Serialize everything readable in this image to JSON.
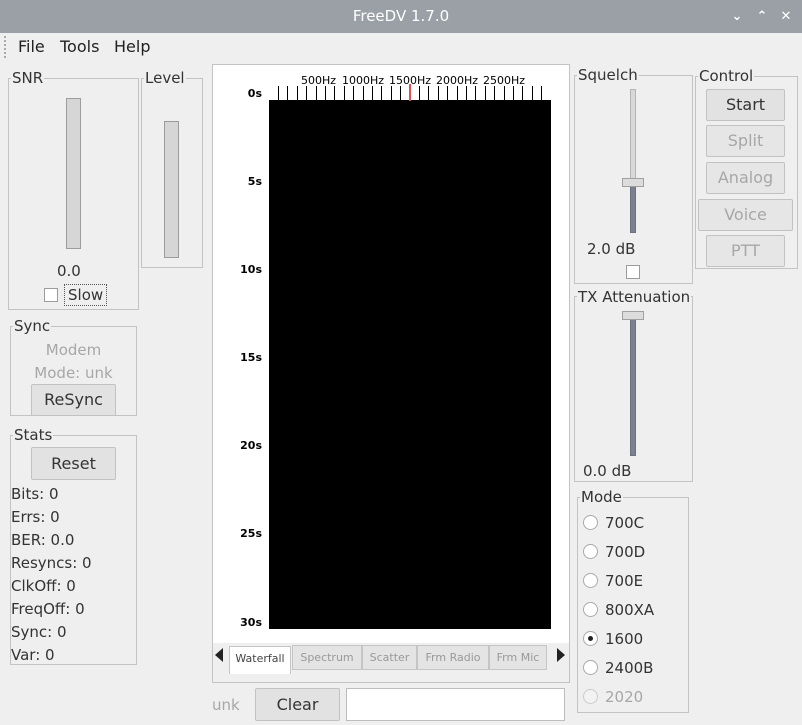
{
  "window": {
    "title": "FreeDV 1.7.0"
  },
  "menu": {
    "file": "File",
    "tools": "Tools",
    "help": "Help"
  },
  "snr": {
    "label": "SNR",
    "value": "0.0",
    "slow_label": "Slow"
  },
  "level": {
    "label": "Level"
  },
  "sync": {
    "label": "Sync",
    "modem": "Modem",
    "mode": "Mode: unk",
    "resync_label": "ReSync"
  },
  "stats": {
    "label": "Stats",
    "reset_label": "Reset",
    "lines": [
      "Bits: 0",
      "Errs: 0",
      "BER: 0.0",
      "Resyncs: 0",
      "ClkOff: 0",
      "FreqOff: 0",
      "Sync: 0",
      "Var: 0"
    ]
  },
  "waterfall": {
    "time_labels": [
      "0s",
      "5s",
      "10s",
      "15s",
      "20s",
      "25s",
      "30s"
    ],
    "freq_labels": [
      "500Hz",
      "1000Hz",
      "1500Hz",
      "2000Hz",
      "2500Hz"
    ],
    "background": "#000000",
    "marker_color": "#e05050"
  },
  "tabs": [
    "Waterfall",
    "Spectrum",
    "Scatter",
    "Frm Radio",
    "Frm Mic"
  ],
  "bottom": {
    "status": "unk",
    "clear_label": "Clear",
    "text_value": ""
  },
  "squelch": {
    "label": "Squelch",
    "value": "2.0 dB"
  },
  "tx_attenuation": {
    "label": "TX Attenuation",
    "value": "0.0 dB"
  },
  "control": {
    "label": "Control",
    "start": "Start",
    "split": "Split",
    "analog": "Analog",
    "voice_keyer": "Voice Keyer",
    "ptt": "PTT"
  },
  "mode": {
    "label": "Mode",
    "options": [
      "700C",
      "700D",
      "700E",
      "800XA",
      "1600",
      "2400B",
      "2020"
    ],
    "selected": "1600"
  }
}
